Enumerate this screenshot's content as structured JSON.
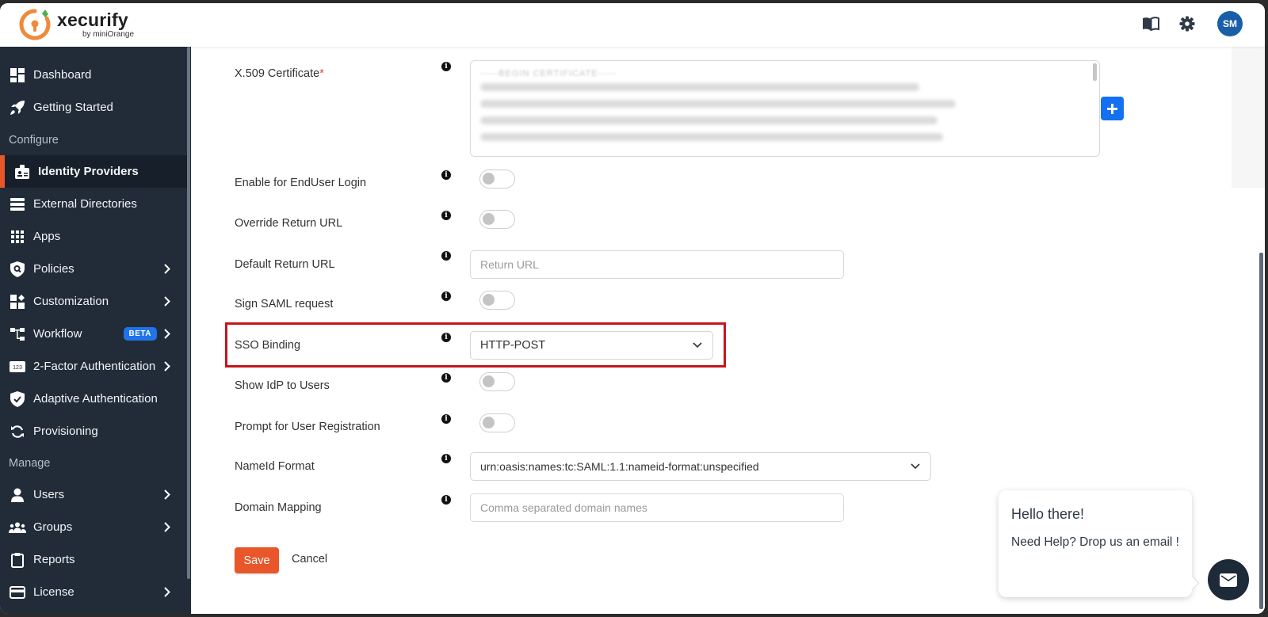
{
  "header": {
    "brand_name": "xecurify",
    "brand_byline": "by miniOrange",
    "icons": [
      "book-icon",
      "gear-icon"
    ],
    "avatar_initials": "SM"
  },
  "sidebar": {
    "items": [
      {
        "label": "Dashboard",
        "icon": "dashboard-icon",
        "chevron": false
      },
      {
        "label": "Getting Started",
        "icon": "rocket-icon",
        "chevron": false
      },
      {
        "section": "Configure"
      },
      {
        "label": "Identity Providers",
        "icon": "id-badge-icon",
        "chevron": false,
        "active": true
      },
      {
        "label": "External Directories",
        "icon": "server-list-icon",
        "chevron": false
      },
      {
        "label": "Apps",
        "icon": "apps-grid-icon",
        "chevron": false
      },
      {
        "label": "Policies",
        "icon": "shield-search-icon",
        "chevron": true
      },
      {
        "label": "Customization",
        "icon": "customization-icon",
        "chevron": true
      },
      {
        "label": "Workflow",
        "icon": "workflow-icon",
        "chevron": true,
        "badge": "BETA"
      },
      {
        "label": "2-Factor Authentication",
        "icon": "numbers-123-icon",
        "chevron": true
      },
      {
        "label": "Adaptive Authentication",
        "icon": "shield-check-icon",
        "chevron": false
      },
      {
        "label": "Provisioning",
        "icon": "sync-icon",
        "chevron": false
      },
      {
        "section": "Manage"
      },
      {
        "label": "Users",
        "icon": "user-icon",
        "chevron": true
      },
      {
        "label": "Groups",
        "icon": "users-group-icon",
        "chevron": true
      },
      {
        "label": "Reports",
        "icon": "clipboard-icon",
        "chevron": false
      },
      {
        "label": "License",
        "icon": "credit-card-icon",
        "chevron": true
      }
    ],
    "labels": {
      "dashboard": "Dashboard",
      "getting_started": "Getting Started",
      "configure": "Configure",
      "identity_providers": "Identity Providers",
      "external_directories": "External Directories",
      "apps": "Apps",
      "policies": "Policies",
      "customization": "Customization",
      "workflow": "Workflow",
      "workflow_badge": "BETA",
      "two_factor": "2-Factor Authentication",
      "adaptive": "Adaptive Authentication",
      "provisioning": "Provisioning",
      "manage": "Manage",
      "users": "Users",
      "groups": "Groups",
      "reports": "Reports",
      "license": "License"
    }
  },
  "form": {
    "certificate": {
      "label": "X.509 Certificate",
      "required_mark": "*",
      "value_header": "-----BEGIN CERTIFICATE-----",
      "value_note": "certificate contents blurred"
    },
    "enable_enduser_login": {
      "label": "Enable for EndUser Login",
      "enabled": false
    },
    "override_return_url": {
      "label": "Override Return URL",
      "enabled": false
    },
    "default_return_url": {
      "label": "Default Return URL",
      "value": "",
      "placeholder": "Return URL"
    },
    "sign_saml_request": {
      "label": "Sign SAML request",
      "enabled": false
    },
    "sso_binding": {
      "label": "SSO Binding",
      "selected": "HTTP-POST",
      "highlighted": true
    },
    "show_idp_to_users": {
      "label": "Show IdP to Users",
      "enabled": false
    },
    "prompt_user_registration": {
      "label": "Prompt for User Registration",
      "enabled": false
    },
    "nameid_format": {
      "label": "NameId Format",
      "selected": "urn:oasis:names:tc:SAML:1.1:nameid-format:unspecified"
    },
    "domain_mapping": {
      "label": "Domain Mapping",
      "value": "",
      "placeholder": "Comma separated domain names"
    },
    "save_label": "Save",
    "cancel_label": "Cancel"
  },
  "help_widget": {
    "title": "Hello there!",
    "message": "Need Help? Drop us an email !"
  },
  "colors": {
    "accent_orange": "#e8562a",
    "sidebar_bg": "#212c38",
    "primary_blue": "#1370f0",
    "highlight_red": "#c8141c",
    "avatar_blue": "#1a5ea8"
  }
}
